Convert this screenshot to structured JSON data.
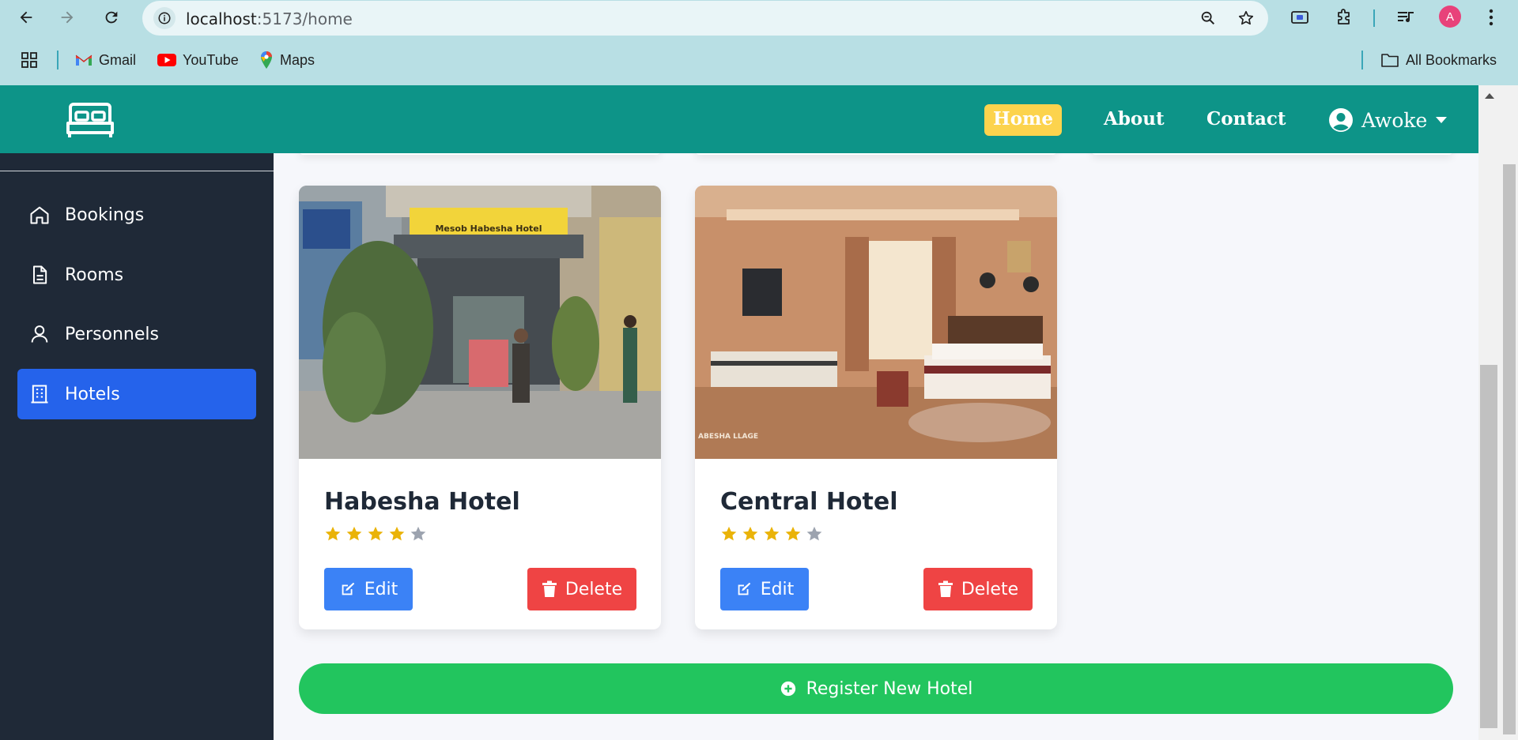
{
  "browser": {
    "url_host": "localhost",
    "url_path": ":5173/home",
    "avatar_letter": "A",
    "bookmarks": [
      {
        "label": "Gmail",
        "icon": "gmail-icon"
      },
      {
        "label": "YouTube",
        "icon": "youtube-icon"
      },
      {
        "label": "Maps",
        "icon": "maps-icon"
      }
    ],
    "all_bookmarks": "All Bookmarks"
  },
  "header": {
    "nav": {
      "home": "Home",
      "about": "About",
      "contact": "Contact"
    },
    "user": "Awoke"
  },
  "sidebar": {
    "items": [
      {
        "label": "Bookings",
        "icon": "home-icon"
      },
      {
        "label": "Rooms",
        "icon": "document-icon"
      },
      {
        "label": "Personnels",
        "icon": "user-icon"
      },
      {
        "label": "Hotels",
        "icon": "building-icon"
      }
    ],
    "active": "Hotels"
  },
  "hotels": [
    {
      "name": "Habesha Hotel",
      "rating": 4,
      "max_rating": 5,
      "image_sign": "Mesob Habesha Hotel"
    },
    {
      "name": "Central Hotel",
      "rating": 4,
      "max_rating": 5,
      "image_sign": "ABESHA LLAGE"
    }
  ],
  "buttons": {
    "edit": "Edit",
    "delete": "Delete",
    "register": "Register New Hotel"
  },
  "colors": {
    "header": "#0d9488",
    "sidebar": "#1f2937",
    "active_item": "#2563eb",
    "edit": "#3b82f6",
    "delete": "#ef4444",
    "register": "#22c55e",
    "star_filled": "#eab308",
    "star_empty": "#9ca3af",
    "home_badge": "#fcd34d"
  }
}
